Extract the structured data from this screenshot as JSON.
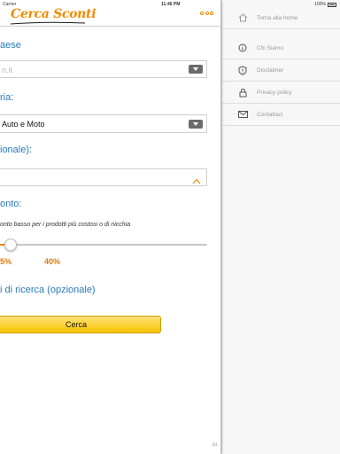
{
  "status_bar": {
    "carrier": "Carrier",
    "time": "11:46 PM",
    "battery": "100%"
  },
  "header": {
    "logo_text": "Cerca Sconti",
    "brand_color": "#f08a00"
  },
  "form": {
    "country_label": "aese",
    "country_value": "n.it",
    "category_label": "ria:",
    "category_value": "Auto e Moto",
    "optional_label": "ionale):",
    "discount_label": "onto:",
    "discount_hint": "onto basso per i prodotti più costosi o di nicchia",
    "slider_min_label": "5%",
    "slider_max_label": "40%",
    "slider_level_percent": 7,
    "keywords_label": "i di ricerca (opzionale)",
    "search_button": "Cerca",
    "accent_color": "#2979b9"
  },
  "side_menu": {
    "items": [
      {
        "label": "Torna alla home",
        "icon": "home-icon"
      },
      {
        "label": "Chi Siamo",
        "icon": "info-icon"
      },
      {
        "label": "Disclaimer",
        "icon": "alert-icon"
      },
      {
        "label": "Privacy policy",
        "icon": "lock-icon"
      },
      {
        "label": "Contattaci",
        "icon": "mail-icon"
      }
    ]
  },
  "footer": {
    "corner_text": "lid"
  }
}
